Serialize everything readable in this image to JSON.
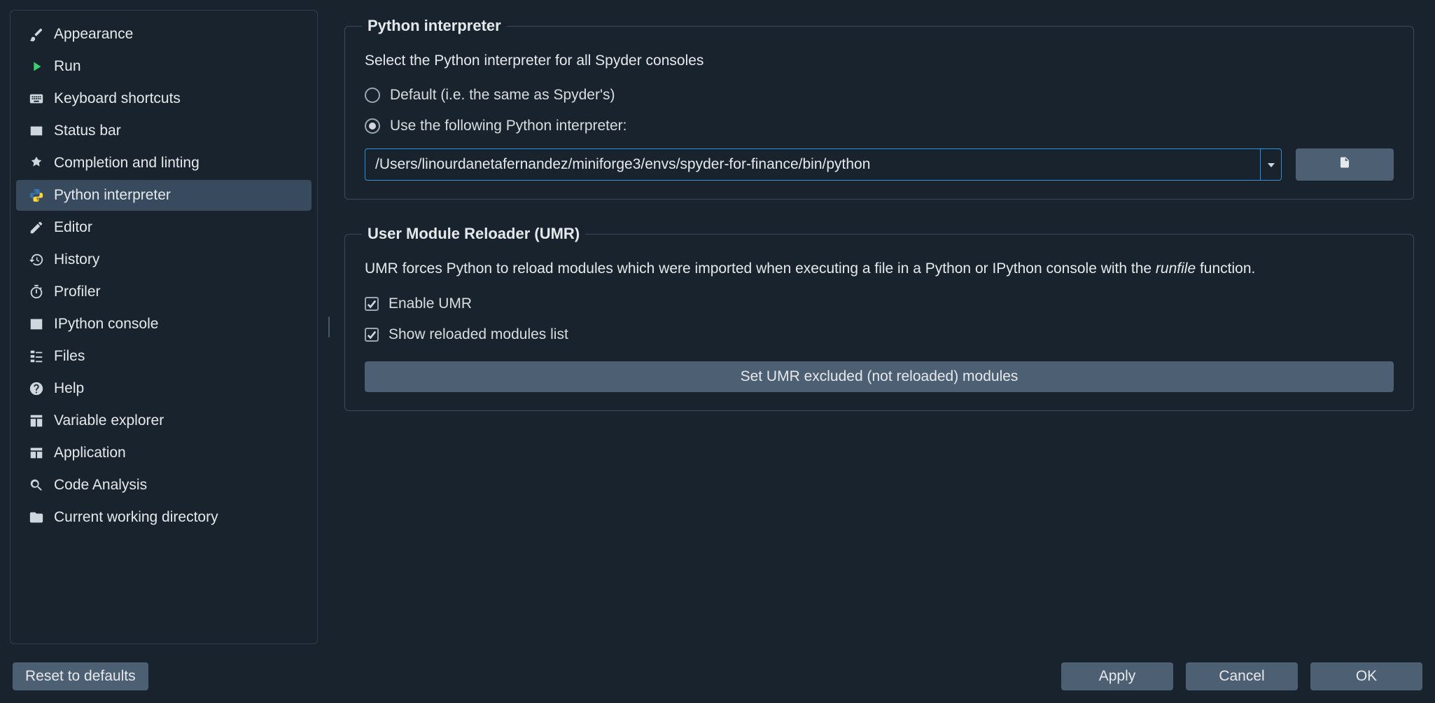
{
  "sidebar": {
    "items": [
      {
        "id": "appearance",
        "label": "Appearance",
        "active": false
      },
      {
        "id": "run",
        "label": "Run",
        "active": false
      },
      {
        "id": "keyboard-shortcuts",
        "label": "Keyboard shortcuts",
        "active": false
      },
      {
        "id": "status-bar",
        "label": "Status bar",
        "active": false
      },
      {
        "id": "completion-linting",
        "label": "Completion and linting",
        "active": false
      },
      {
        "id": "python-interpreter",
        "label": "Python interpreter",
        "active": true
      },
      {
        "id": "editor",
        "label": "Editor",
        "active": false
      },
      {
        "id": "history",
        "label": "History",
        "active": false
      },
      {
        "id": "profiler",
        "label": "Profiler",
        "active": false
      },
      {
        "id": "ipython-console",
        "label": "IPython console",
        "active": false
      },
      {
        "id": "files",
        "label": "Files",
        "active": false
      },
      {
        "id": "help",
        "label": "Help",
        "active": false
      },
      {
        "id": "variable-explorer",
        "label": "Variable explorer",
        "active": false
      },
      {
        "id": "application",
        "label": "Application",
        "active": false
      },
      {
        "id": "code-analysis",
        "label": "Code Analysis",
        "active": false
      },
      {
        "id": "cwd",
        "label": "Current working directory",
        "active": false
      }
    ]
  },
  "interpreter": {
    "legend": "Python interpreter",
    "desc": "Select the Python interpreter for all Spyder consoles",
    "option_default": "Default (i.e. the same as Spyder's)",
    "option_custom": "Use the following Python interpreter:",
    "selected": "custom",
    "path": "/Users/linourdanetafernandez/miniforge3/envs/spyder-for-finance/bin/python"
  },
  "umr": {
    "legend": "User Module Reloader (UMR)",
    "desc_pre": "UMR forces Python to reload modules which were imported when executing a file in a Python or IPython console with the ",
    "desc_em": "runfile",
    "desc_post": " function.",
    "enable_label": "Enable UMR",
    "enable_checked": true,
    "show_label": "Show reloaded modules list",
    "show_checked": true,
    "excluded_btn": "Set UMR excluded (not reloaded) modules"
  },
  "footer": {
    "reset": "Reset to defaults",
    "apply": "Apply",
    "cancel": "Cancel",
    "ok": "OK"
  }
}
